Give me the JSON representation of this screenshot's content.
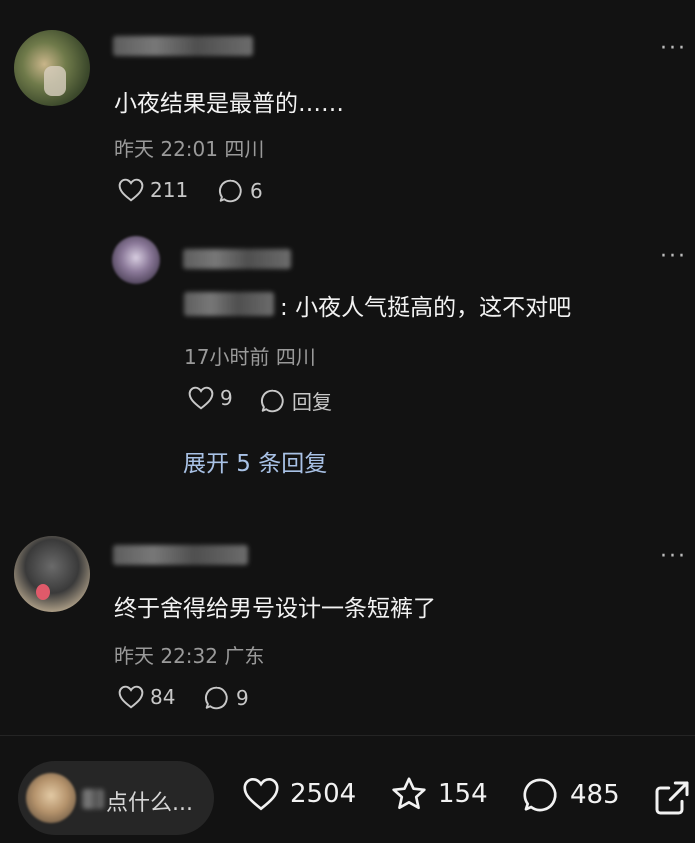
{
  "comments": [
    {
      "text": "小夜结果是最普的……",
      "time": "昨天 22:01",
      "location": "四川",
      "likes": "211",
      "replies": "6"
    },
    {
      "reply_prefix": ":",
      "text": "小夜人气挺高的，这不对吧",
      "time": "17小时前",
      "location": "四川",
      "likes": "9",
      "reply_label": "回复",
      "expand_label": "展开 5 条回复"
    },
    {
      "text": "终于舍得给男号设计一条短裤了",
      "time": "昨天 22:32",
      "location": "广东",
      "likes": "84",
      "replies": "9"
    }
  ],
  "bottom_bar": {
    "input_placeholder": "点什么...",
    "likes": "2504",
    "favorites": "154",
    "comments": "485"
  },
  "colors": {
    "background": "#121212",
    "text": "#f2f2f2",
    "meta": "#9a9a9a",
    "link": "#a9c2e6"
  },
  "icons": [
    "more-icon",
    "heart-icon",
    "comment-icon",
    "star-icon",
    "share-icon"
  ]
}
